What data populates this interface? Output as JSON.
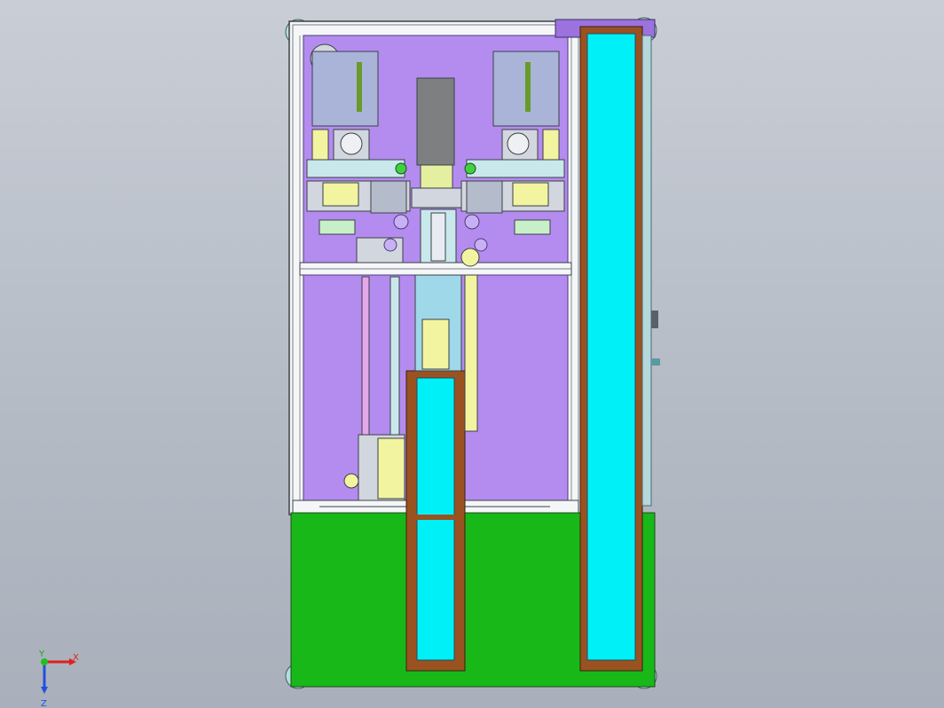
{
  "viewport": {
    "background_top": "#c9ced6",
    "background_bottom": "#a9b0bb"
  },
  "colors": {
    "frame_white": "#f4f6f8",
    "frame_edge": "#5a5f66",
    "plate_purple": "#b48cf0",
    "plate_purple_dark": "#9b72de",
    "base_green": "#18b818",
    "chute_cyan": "#00f0f8",
    "chute_brown": "#9a5220",
    "carriage_yellow": "#f2f4a0",
    "block_gray": "#d2d6de",
    "slider_dark": "#7d7f80",
    "corner_teal": "#aee0e0",
    "rail_pink": "#e4a8e8"
  },
  "triad": {
    "x_label": "X",
    "y_label": "Y",
    "z_label": "Z"
  }
}
